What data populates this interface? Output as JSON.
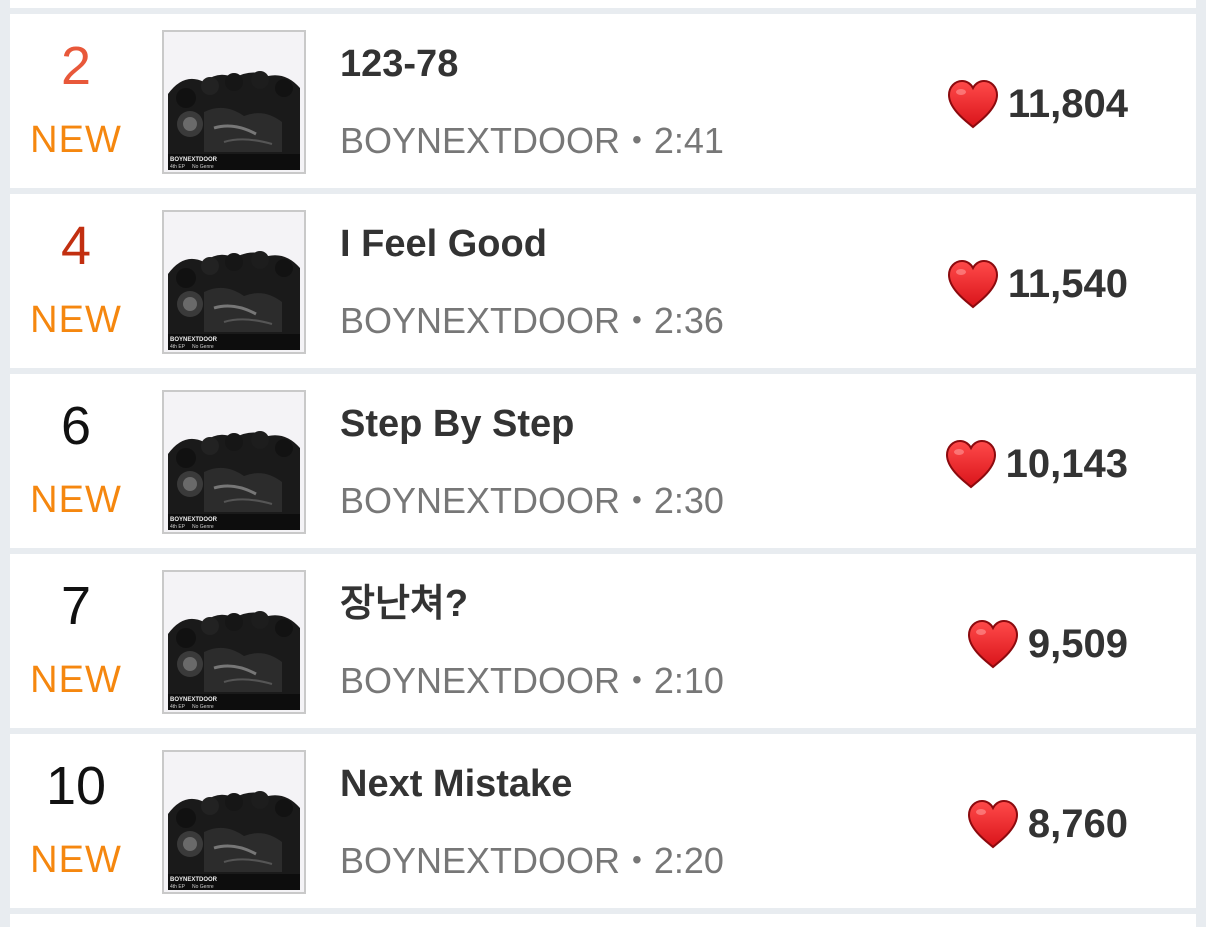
{
  "colors": {
    "rank_up": "#e8583a",
    "rank_up_dark": "#c22f10",
    "rank_default": "#111111",
    "badge_new": "#f5870f",
    "heart": "#d9141a",
    "row_bg": "#ffffff",
    "page_bg": "#e8ecf0"
  },
  "tracks": [
    {
      "rank": "2",
      "rank_color": "#e8583a",
      "badge": "NEW",
      "title": "123-78",
      "artist": "BOYNEXTDOOR",
      "duration": "2:41",
      "likes": "11,804",
      "cover_icon": "album-cover-boynextdoor"
    },
    {
      "rank": "4",
      "rank_color": "#c22f10",
      "badge": "NEW",
      "title": "I Feel Good",
      "artist": "BOYNEXTDOOR",
      "duration": "2:36",
      "likes": "11,540",
      "cover_icon": "album-cover-boynextdoor"
    },
    {
      "rank": "6",
      "rank_color": "#111111",
      "badge": "NEW",
      "title": "Step By Step",
      "artist": "BOYNEXTDOOR",
      "duration": "2:30",
      "likes": "10,143",
      "cover_icon": "album-cover-boynextdoor"
    },
    {
      "rank": "7",
      "rank_color": "#111111",
      "badge": "NEW",
      "title": "장난쳐?",
      "artist": "BOYNEXTDOOR",
      "duration": "2:10",
      "likes": "9,509",
      "cover_icon": "album-cover-boynextdoor"
    },
    {
      "rank": "10",
      "rank_color": "#111111",
      "badge": "NEW",
      "title": "Next Mistake",
      "artist": "BOYNEXTDOOR",
      "duration": "2:20",
      "likes": "8,760",
      "cover_icon": "album-cover-boynextdoor"
    }
  ],
  "separator": "•",
  "icons": {
    "like": "heart-icon"
  }
}
